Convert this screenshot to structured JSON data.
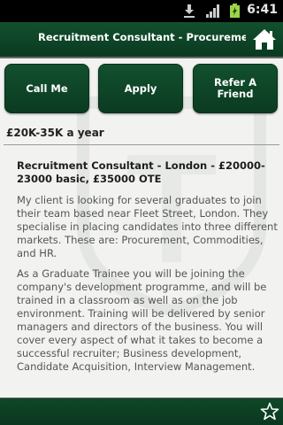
{
  "status_bar": {
    "time": "6:41",
    "icons": [
      "download-icon",
      "signal-icon",
      "battery-icon"
    ]
  },
  "header": {
    "title": "Recruitment Consultant - Procurement",
    "home_icon": "home-icon"
  },
  "actions": {
    "call_label": "Call Me",
    "apply_label": "Apply",
    "refer_label": "Refer A Friend"
  },
  "job": {
    "salary": "£20K-35K a year",
    "heading": "Recruitment Consultant - London - £20000-23000 basic, £35000 OTE",
    "paragraph_1": "My client is looking for several graduates to join their team based near Fleet Street, London. They specialise in placing candidates into three different markets. These are: Procurement, Commodities, and HR.",
    "paragraph_2": "As a Graduate Trainee you will be joining the company's development programme, and will be trained in a classroom as well as on the job environment. Training will be delivered by senior managers and directors of the business. You will cover every aspect of what it takes to become a successful recruiter; Business development, Candidate Acquisition, Interview Management."
  },
  "bottom_bar": {
    "favorite_icon": "star-icon"
  },
  "colors": {
    "header_green": "#0f4828",
    "background": "#f2f2f0"
  }
}
